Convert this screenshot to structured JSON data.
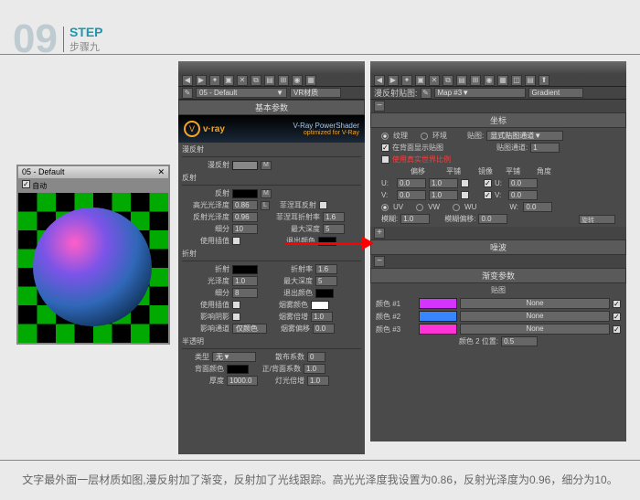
{
  "step": {
    "num": "09",
    "label": "STEP",
    "sub": "步骤九"
  },
  "preview": {
    "title": "05 - Default",
    "auto": "自动"
  },
  "mat": {
    "dropdown_mat": "05 - Default",
    "dropdown_type": "VR材质",
    "basic": "基本参数",
    "vray": {
      "title": "V-Ray PowerShader",
      "sub": "optimized for V-Ray",
      "brand": "v·ray"
    },
    "diffuse": {
      "group": "漫反射",
      "label": "漫反射",
      "m": "M"
    },
    "reflect": {
      "group": "反射",
      "label": "反射",
      "m": "M",
      "hl": "高光光泽度",
      "hl_v": "0.86",
      "rg": "反射光泽度",
      "rg_v": "0.96",
      "sub": "细分",
      "sub_v": "10",
      "interp": "使用插值",
      "fresnel": "菲涅耳反射",
      "fior": "菲涅耳折射率",
      "fior_v": "1.6",
      "depth": "最大深度",
      "depth_v": "5",
      "exit": "退出颜色",
      "L": "L"
    },
    "refract": {
      "group": "折射",
      "label": "折射",
      "gloss": "光泽度",
      "gloss_v": "1.0",
      "sub": "细分",
      "sub_v": "8",
      "interp": "使用插值",
      "shadow": "影响阴影",
      "alpha": "影响通道",
      "alpha_v": "仅颜色",
      "ior": "折射率",
      "ior_v": "1.6",
      "depth": "最大深度",
      "depth_v": "5",
      "exit": "退出颜色",
      "fog": "烟雾颜色",
      "fogm": "烟雾倍增",
      "fogm_v": "1.0",
      "fogb": "烟雾偏移",
      "fogb_v": "0.0"
    },
    "trans": {
      "group": "半透明",
      "type": "类型",
      "type_v": "无",
      "scatter": "散布系数",
      "scatter_v": "0",
      "back": "背面颜色",
      "fb": "正/背面系数",
      "fb_v": "1.0",
      "thick": "厚度",
      "thick_v": "1000.0",
      "light": "灯光倍增",
      "light_v": "1.0"
    }
  },
  "map": {
    "slot": "漫反射贴图:",
    "slot_val": "Map #3",
    "slot_type": "Gradient",
    "coord": {
      "title": "坐标",
      "texture": "纹理",
      "env": "环境",
      "maplabel": "贴图:",
      "map_val": "显式贴图通道",
      "show": "在背面显示贴图",
      "chan": "贴图通道:",
      "chan_v": "1",
      "real": "使用真实世界比例",
      "offset": "偏移",
      "tile": "平铺",
      "mirror": "镜像",
      "tile2": "平铺",
      "angle": "角度",
      "u": "U:",
      "v": "V:",
      "w": "W:",
      "u_off": "0.0",
      "u_tile": "1.0",
      "u_ang": "0.0",
      "v_off": "0.0",
      "v_tile": "1.0",
      "v_ang": "0.0",
      "w_ang": "0.0",
      "uv": "UV",
      "vw": "VW",
      "wu": "WU",
      "blur": "模糊:",
      "blur_v": "1.0",
      "bluroff": "模糊偏移:",
      "bluroff_v": "0.0",
      "rotate": "旋转"
    },
    "noise": "噪波",
    "grad": {
      "title": "渐变参数",
      "maps": "贴图",
      "c1": "颜色 #1",
      "c2": "颜色 #2",
      "c3": "颜色 #3",
      "pos": "颜色 2 位置:",
      "pos_v": "0.5",
      "none": "None"
    }
  },
  "colors": {
    "c1": "#d533ff",
    "c2": "#3786ff",
    "c3": "#ff33d5"
  },
  "caption": "文字最外面一层材质如图,漫反射加了渐变，反射加了光线跟踪。高光光泽度我设置为0.86，反射光泽度为0.96，细分为10。"
}
